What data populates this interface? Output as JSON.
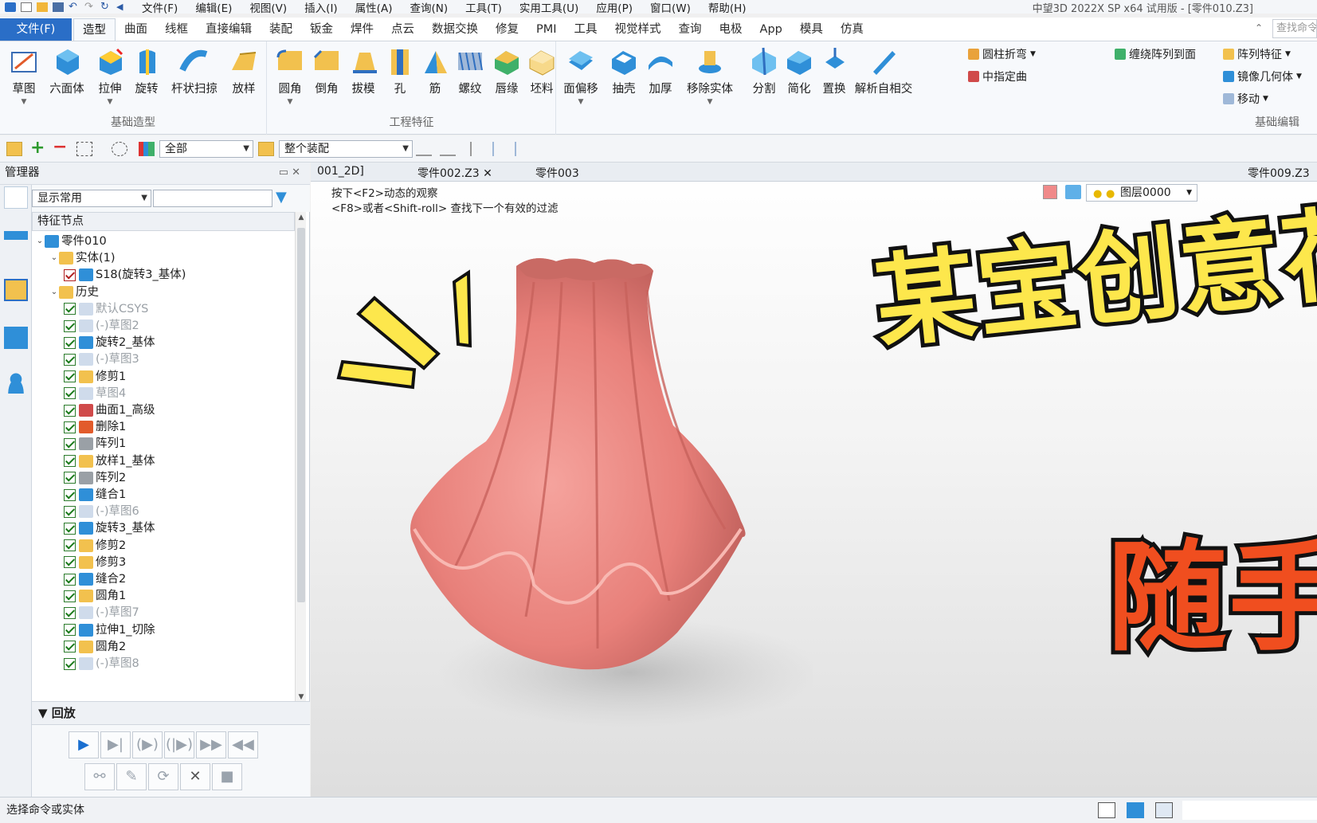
{
  "app": {
    "title": "中望3D 2022X SP x64 试用版 - [零件010.Z3]"
  },
  "menu": [
    "文件(F)",
    "编辑(E)",
    "视图(V)",
    "插入(I)",
    "属性(A)",
    "查询(N)",
    "工具(T)",
    "实用工具(U)",
    "应用(P)",
    "窗口(W)",
    "帮助(H)"
  ],
  "ribbon_tabs": [
    "文件(F)",
    "造型",
    "曲面",
    "线框",
    "直接编辑",
    "装配",
    "钣金",
    "焊件",
    "点云",
    "数据交换",
    "修复",
    "PMI",
    "工具",
    "视觉样式",
    "查询",
    "电极",
    "App",
    "模具",
    "仿真"
  ],
  "ribbon_active_tab": "造型",
  "search_placeholder": "查找命令",
  "ribbon": {
    "groups": [
      {
        "label": "基础造型",
        "buttons": [
          "草图",
          "六面体",
          "拉伸",
          "旋转",
          "杆状扫掠",
          "放样"
        ]
      },
      {
        "label": "工程特征",
        "buttons": [
          "圆角",
          "倒角",
          "拔模",
          "孔",
          "筋",
          "螺纹",
          "唇缘",
          "坯料"
        ]
      },
      {
        "label": "基础编辑",
        "buttons": [
          "面偏移",
          "抽壳",
          "加厚",
          "移除实体",
          "分割",
          "简化",
          "置换",
          "解析自相交"
        ]
      }
    ],
    "small_buttons": [
      "圆柱折弯",
      "中指定曲",
      "缠绕阵列到面",
      "阵列特征",
      "镜像几何体",
      "移动"
    ]
  },
  "toolbar": {
    "filter_combo": "全部",
    "assembly_combo": "整个装配"
  },
  "manager": {
    "title": "管理器",
    "display_combo": "显示常用",
    "column_header": "特征节点",
    "tree": [
      {
        "label": "零件010",
        "level": 0,
        "toggle": "v",
        "check": "none",
        "icon": "part",
        "dim": false
      },
      {
        "label": "实体(1)",
        "level": 1,
        "toggle": "v",
        "check": "none",
        "icon": "solid",
        "dim": false
      },
      {
        "label": "S18(旋转3_基体)",
        "level": 2,
        "toggle": "",
        "check": "red",
        "icon": "cube",
        "dim": false
      },
      {
        "label": "历史",
        "level": 1,
        "toggle": "v",
        "check": "none",
        "icon": "folder",
        "dim": false
      },
      {
        "label": "默认CSYS",
        "level": 2,
        "toggle": "",
        "check": "green",
        "icon": "csys",
        "dim": true
      },
      {
        "label": "(-)草图2",
        "level": 2,
        "toggle": "",
        "check": "green",
        "icon": "sketch",
        "dim": true
      },
      {
        "label": "旋转2_基体",
        "level": 2,
        "toggle": "",
        "check": "green",
        "icon": "revolve",
        "dim": false
      },
      {
        "label": "(-)草图3",
        "level": 2,
        "toggle": "",
        "check": "green",
        "icon": "sketch",
        "dim": true
      },
      {
        "label": "修剪1",
        "level": 2,
        "toggle": "",
        "check": "green",
        "icon": "trim",
        "dim": false
      },
      {
        "label": "草图4",
        "level": 2,
        "toggle": "",
        "check": "green",
        "icon": "sketch",
        "dim": true
      },
      {
        "label": "曲面1_高级",
        "level": 2,
        "toggle": "",
        "check": "green",
        "icon": "surface",
        "dim": false
      },
      {
        "label": "删除1",
        "level": 2,
        "toggle": "",
        "check": "green",
        "icon": "delete",
        "dim": false
      },
      {
        "label": "阵列1",
        "level": 2,
        "toggle": "",
        "check": "green",
        "icon": "pattern",
        "dim": false
      },
      {
        "label": "放样1_基体",
        "level": 2,
        "toggle": "",
        "check": "green",
        "icon": "loft",
        "dim": false
      },
      {
        "label": "阵列2",
        "level": 2,
        "toggle": "",
        "check": "green",
        "icon": "pattern",
        "dim": false
      },
      {
        "label": "缝合1",
        "level": 2,
        "toggle": "",
        "check": "green",
        "icon": "cube",
        "dim": false
      },
      {
        "label": "(-)草图6",
        "level": 2,
        "toggle": "",
        "check": "green",
        "icon": "sketch",
        "dim": true
      },
      {
        "label": "旋转3_基体",
        "level": 2,
        "toggle": "",
        "check": "green",
        "icon": "revolve",
        "dim": false
      },
      {
        "label": "修剪2",
        "level": 2,
        "toggle": "",
        "check": "green",
        "icon": "trim",
        "dim": false
      },
      {
        "label": "修剪3",
        "level": 2,
        "toggle": "",
        "check": "green",
        "icon": "trim",
        "dim": false
      },
      {
        "label": "缝合2",
        "level": 2,
        "toggle": "",
        "check": "green",
        "icon": "cube",
        "dim": false
      },
      {
        "label": "圆角1",
        "level": 2,
        "toggle": "",
        "check": "green",
        "icon": "fillet",
        "dim": false
      },
      {
        "label": "(-)草图7",
        "level": 2,
        "toggle": "",
        "check": "green",
        "icon": "sketch",
        "dim": true
      },
      {
        "label": "拉伸1_切除",
        "level": 2,
        "toggle": "",
        "check": "green",
        "icon": "extrude",
        "dim": false
      },
      {
        "label": "圆角2",
        "level": 2,
        "toggle": "",
        "check": "green",
        "icon": "fillet",
        "dim": false
      },
      {
        "label": "(-)草图8",
        "level": 2,
        "toggle": "",
        "check": "green",
        "icon": "sketch",
        "dim": true
      }
    ],
    "playback_title": "回放"
  },
  "doc_tabs": [
    "001_2D]",
    "零件002.Z3",
    "零件003",
    "零件009.Z3"
  ],
  "viewport": {
    "hint_line1": "按下<F2>动态的观察",
    "hint_line2": "<F8>或者<Shift-roll> 查找下一个有效的过滤",
    "layer_combo": "图层0000",
    "overlay_title": "某宝创意花瓶",
    "overlay_subtitle": "随手一画",
    "vase_color": "#e8807a"
  },
  "status": {
    "text": "选择命令或实体"
  },
  "colors": {
    "accent": "#2a6ec7",
    "overlay_yellow": "#fde74c",
    "overlay_red": "#f04e1f"
  }
}
